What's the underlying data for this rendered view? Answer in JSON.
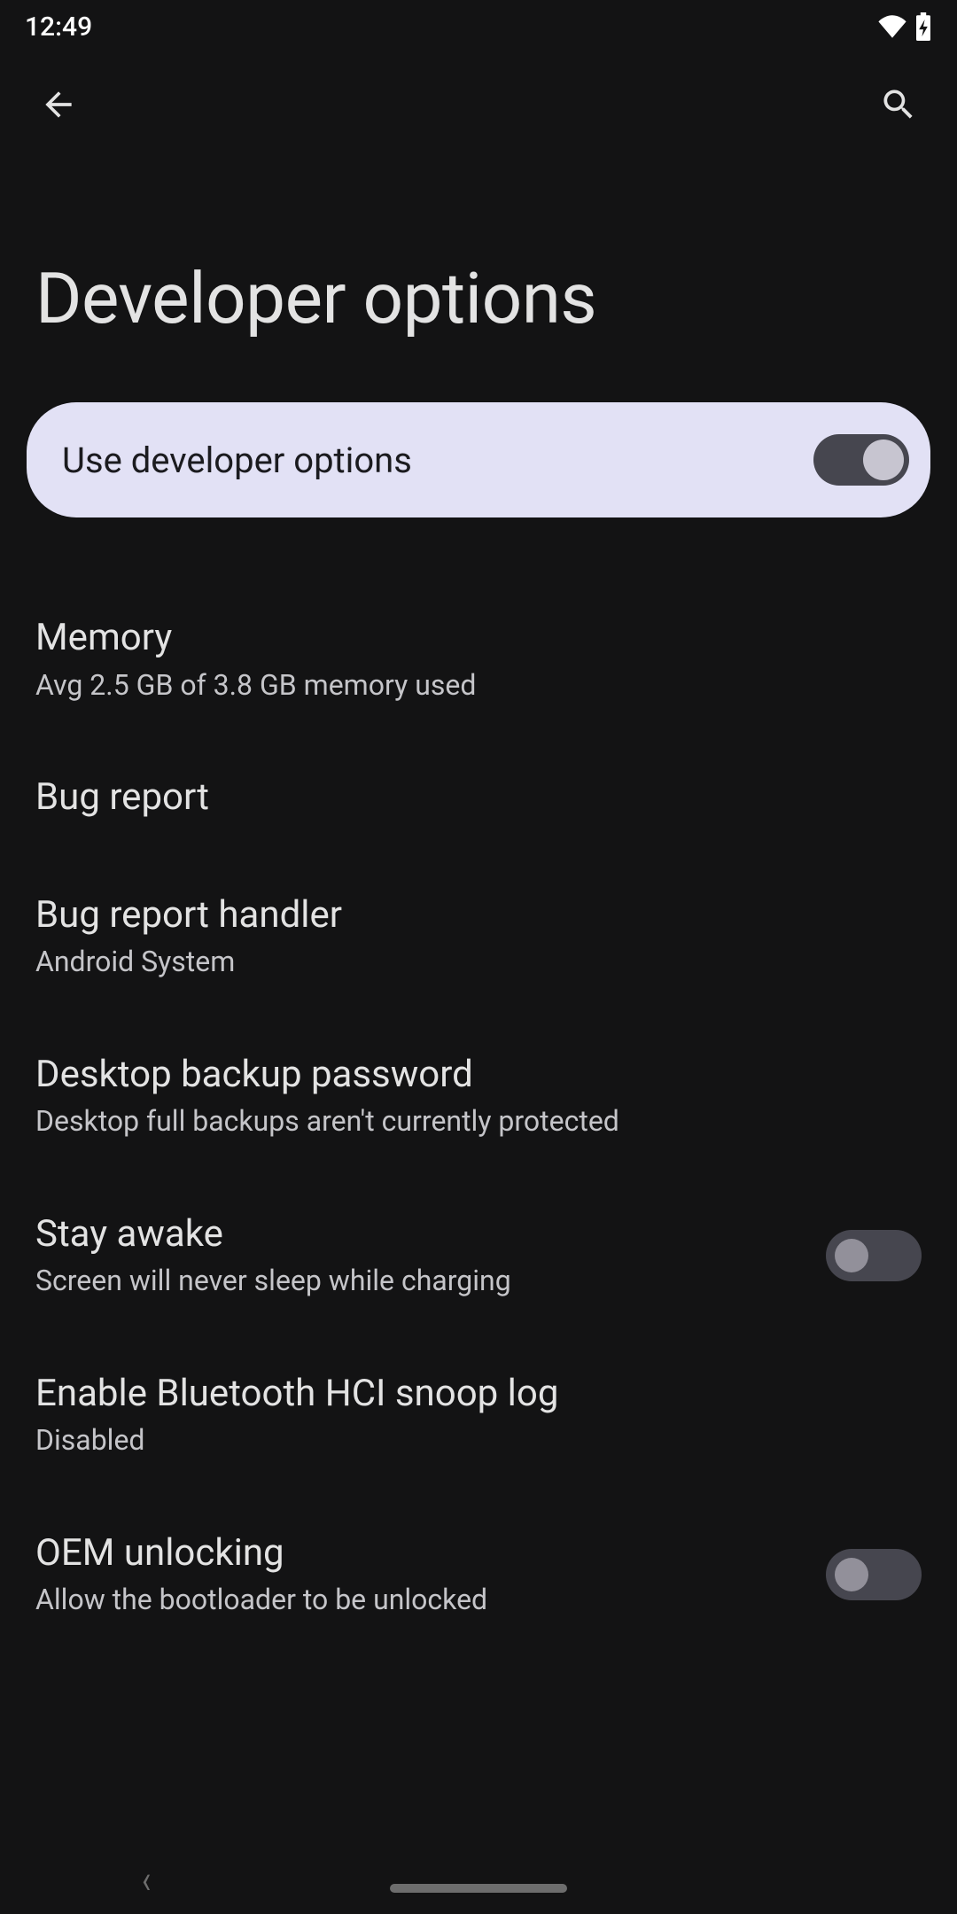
{
  "status": {
    "time": "12:49"
  },
  "header": {
    "title": "Developer options"
  },
  "master": {
    "label": "Use developer options",
    "enabled": true
  },
  "rows": [
    {
      "key": "memory",
      "title": "Memory",
      "subtitle": "Avg 2.5 GB of 3.8 GB memory used",
      "has_switch": false
    },
    {
      "key": "bug-report",
      "title": "Bug report",
      "subtitle": "",
      "has_switch": false
    },
    {
      "key": "bug-report-handler",
      "title": "Bug report handler",
      "subtitle": "Android System",
      "has_switch": false
    },
    {
      "key": "desktop-backup-password",
      "title": "Desktop backup password",
      "subtitle": "Desktop full backups aren't currently protected",
      "has_switch": false
    },
    {
      "key": "stay-awake",
      "title": "Stay awake",
      "subtitle": "Screen will never sleep while charging",
      "has_switch": true,
      "switch_on": false
    },
    {
      "key": "bt-hci-snoop",
      "title": "Enable Bluetooth HCI snoop log",
      "subtitle": "Disabled",
      "has_switch": false
    },
    {
      "key": "oem-unlocking",
      "title": "OEM unlocking",
      "subtitle": "Allow the bootloader to be unlocked",
      "has_switch": true,
      "switch_on": false
    }
  ]
}
